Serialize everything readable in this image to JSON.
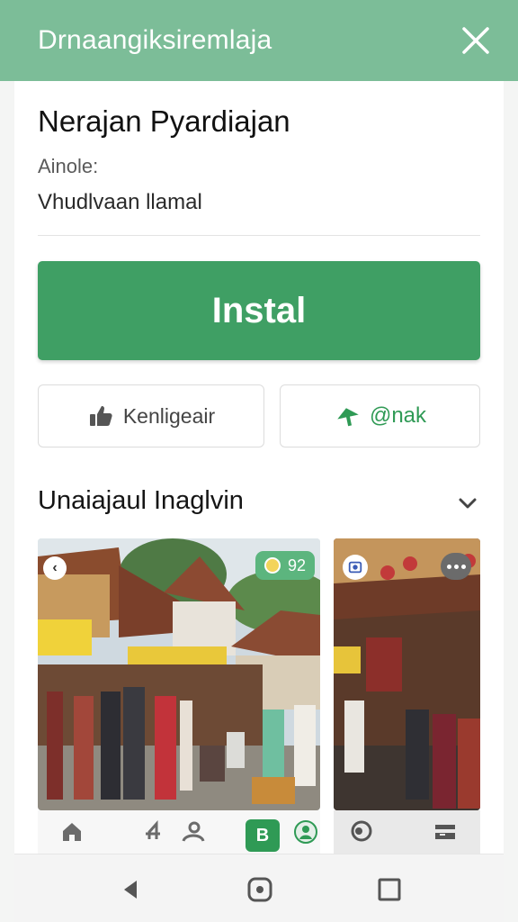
{
  "header": {
    "title": "Drnaangiksiremlaja",
    "close_icon": "close-icon"
  },
  "app": {
    "title": "Nerajan Pyardiajan",
    "meta_label": "Ainole:",
    "meta_value": "Vhudlvaan llamal"
  },
  "install": {
    "label": "Instal",
    "color": "#3f9f64"
  },
  "actions": {
    "like": {
      "label": "Kenligeair",
      "icon": "thumbs-up-icon"
    },
    "share": {
      "label": "@nak",
      "icon": "share-arrow-icon"
    }
  },
  "screenshots": {
    "title": "Unaiajaul Inaglvin",
    "chevron_icon": "chevron-down-icon",
    "items": [
      {
        "badge_count": "92"
      },
      {
        "more_icon": "more-icon"
      }
    ]
  },
  "bottom_nav": {
    "icons": [
      "home-icon",
      "people-icon",
      "active-app-icon",
      "profile-icon",
      "chat-icon",
      "menu-icon"
    ],
    "active_label": "B"
  },
  "system_nav": [
    "back-icon",
    "home-circle-icon",
    "recents-icon"
  ],
  "colors": {
    "header": "#7cbd98",
    "accent": "#2f9a55"
  }
}
